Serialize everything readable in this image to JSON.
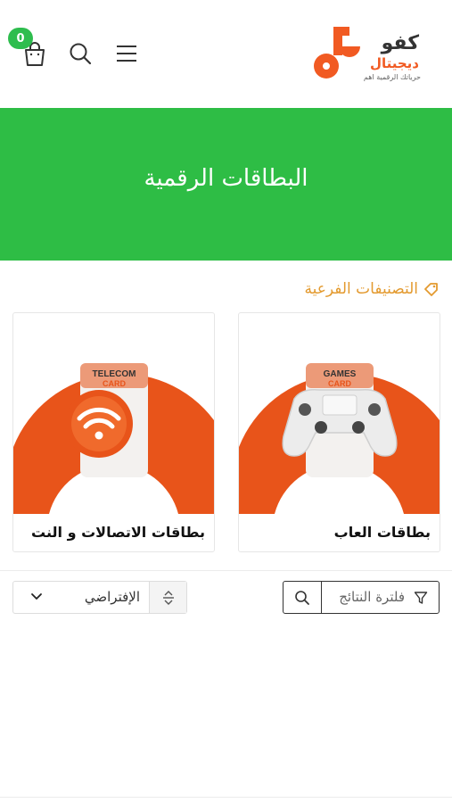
{
  "header": {
    "cart_count": "0",
    "logo_word": "كفو",
    "logo_sub": "ديجيتال",
    "logo_tag": "حرياتك الرقمية اهم"
  },
  "hero": {
    "title": "البطاقات الرقمية"
  },
  "subcategories": {
    "heading": "التصنيفات الفرعية",
    "items": [
      {
        "label": "بطاقات العاب",
        "badge_top": "GAMES",
        "badge_bottom": "CARD"
      },
      {
        "label": "بطاقات الاتصالات و النت",
        "badge_top": "TELECOM",
        "badge_bottom": "CARD"
      }
    ]
  },
  "toolbar": {
    "filter_label": "فلترة النتائج",
    "sort_value": "الإفتراضي"
  },
  "colors": {
    "brand_orange": "#f15a22",
    "hero_green": "#2ebd45",
    "accent_gold": "#e39a2f"
  }
}
